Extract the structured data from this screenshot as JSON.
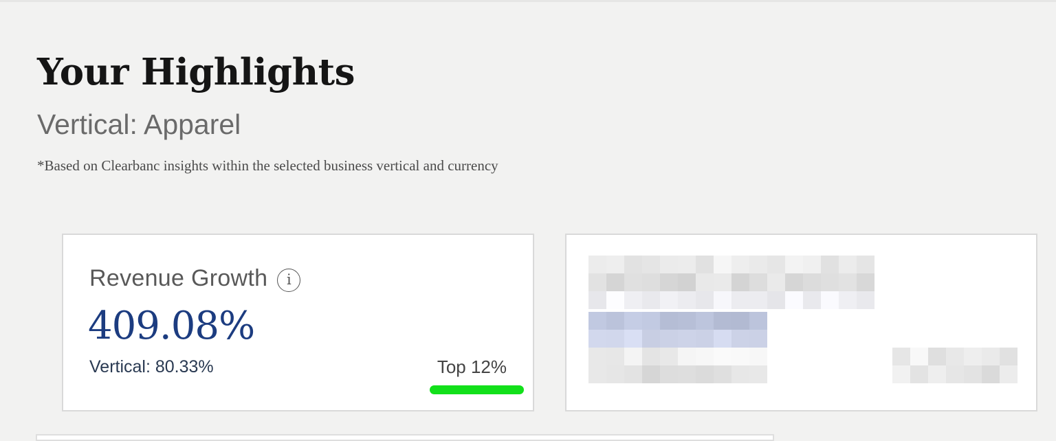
{
  "highlights": {
    "title": "Your Highlights",
    "subtitle": "Vertical: Apparel",
    "footnote": "*Based on Clearbanc insights within the selected business vertical and currency"
  },
  "revenue_card": {
    "title": "Revenue Growth",
    "info_icon": "info-icon",
    "info_glyph": "i",
    "value": "409.08%",
    "vertical_comparison": "Vertical:  80.33%",
    "rank_label": "Top 12%",
    "rank_bar_fill_fraction": 1.0,
    "colors": {
      "value": "#1c3c80",
      "rank_bar": "#12e01a"
    }
  },
  "second_card": {
    "state": "pixelated / obscured content"
  }
}
